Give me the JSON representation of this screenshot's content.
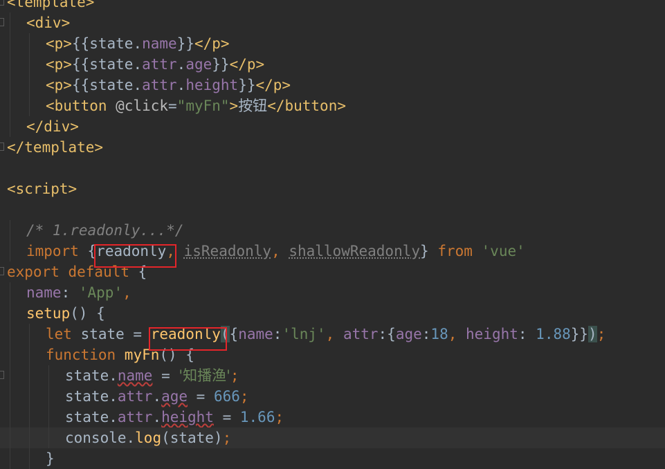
{
  "editor": {
    "lines": [
      {
        "indent": 0,
        "tokens": [
          {
            "t": "<template>",
            "c": "tag"
          }
        ]
      },
      {
        "indent": 1,
        "tokens": [
          {
            "t": "<div>",
            "c": "tag"
          }
        ]
      },
      {
        "indent": 2,
        "tokens": [
          {
            "t": "<p>",
            "c": "tag"
          },
          {
            "t": "{{",
            "c": "plain"
          },
          {
            "t": "state.",
            "c": "plain"
          },
          {
            "t": "name",
            "c": "prop"
          },
          {
            "t": "}}",
            "c": "plain"
          },
          {
            "t": "</p>",
            "c": "tag"
          }
        ]
      },
      {
        "indent": 2,
        "tokens": [
          {
            "t": "<p>",
            "c": "tag"
          },
          {
            "t": "{{",
            "c": "plain"
          },
          {
            "t": "state.",
            "c": "plain"
          },
          {
            "t": "attr",
            "c": "prop"
          },
          {
            "t": ".",
            "c": "plain"
          },
          {
            "t": "age",
            "c": "prop"
          },
          {
            "t": "}}",
            "c": "plain"
          },
          {
            "t": "</p>",
            "c": "tag"
          }
        ]
      },
      {
        "indent": 2,
        "tokens": [
          {
            "t": "<p>",
            "c": "tag"
          },
          {
            "t": "{{",
            "c": "plain"
          },
          {
            "t": "state.",
            "c": "plain"
          },
          {
            "t": "attr",
            "c": "prop"
          },
          {
            "t": ".",
            "c": "plain"
          },
          {
            "t": "height",
            "c": "prop"
          },
          {
            "t": "}}",
            "c": "plain"
          },
          {
            "t": "</p>",
            "c": "tag"
          }
        ]
      },
      {
        "indent": 2,
        "tokens": [
          {
            "t": "<button ",
            "c": "tag"
          },
          {
            "t": "@click",
            "c": "attr-name"
          },
          {
            "t": "=",
            "c": "plain"
          },
          {
            "t": "\"myFn\"",
            "c": "str"
          },
          {
            "t": ">",
            "c": "tag"
          },
          {
            "t": "按钮",
            "c": "plain cjk"
          },
          {
            "t": "</button>",
            "c": "tag"
          }
        ]
      },
      {
        "indent": 1,
        "tokens": [
          {
            "t": "</div>",
            "c": "tag"
          }
        ]
      },
      {
        "indent": 0,
        "tokens": [
          {
            "t": "</template>",
            "c": "tag"
          }
        ]
      },
      {
        "indent": 0,
        "tokens": []
      },
      {
        "indent": 0,
        "tokens": [
          {
            "t": "<script>",
            "c": "tag"
          }
        ]
      },
      {
        "indent": 0,
        "tokens": []
      },
      {
        "indent": 1,
        "tokens": [
          {
            "t": "/* 1.readonly...*/",
            "c": "comment"
          }
        ]
      },
      {
        "indent": 1,
        "tokens": [
          {
            "t": "import ",
            "c": "kw"
          },
          {
            "t": "{",
            "c": "plain"
          },
          {
            "t": "readonly",
            "c": "plain"
          },
          {
            "t": ", ",
            "c": "kw"
          },
          {
            "t": "isReadonly",
            "c": "unused"
          },
          {
            "t": ", ",
            "c": "kw"
          },
          {
            "t": "shallowReadonly",
            "c": "unused"
          },
          {
            "t": "} ",
            "c": "plain"
          },
          {
            "t": "from ",
            "c": "kw"
          },
          {
            "t": "'vue'",
            "c": "str"
          }
        ]
      },
      {
        "indent": 0,
        "tokens": [
          {
            "t": "export default ",
            "c": "kw"
          },
          {
            "t": "{",
            "c": "plain"
          }
        ]
      },
      {
        "indent": 1,
        "tokens": [
          {
            "t": "name",
            "c": "prop"
          },
          {
            "t": ": ",
            "c": "plain"
          },
          {
            "t": "'App'",
            "c": "str"
          },
          {
            "t": ",",
            "c": "kw"
          }
        ]
      },
      {
        "indent": 1,
        "tokens": [
          {
            "t": "setup",
            "c": "fn"
          },
          {
            "t": "() {",
            "c": "plain"
          }
        ]
      },
      {
        "indent": 2,
        "tokens": [
          {
            "t": "let ",
            "c": "kw"
          },
          {
            "t": "state = ",
            "c": "plain"
          },
          {
            "t": "readonly",
            "c": "fn"
          },
          {
            "t": "(",
            "c": "plain bracket-hl"
          },
          {
            "t": "{",
            "c": "plain"
          },
          {
            "t": "name",
            "c": "prop"
          },
          {
            "t": ":",
            "c": "plain"
          },
          {
            "t": "'lnj'",
            "c": "str"
          },
          {
            "t": ", ",
            "c": "kw"
          },
          {
            "t": "attr",
            "c": "prop"
          },
          {
            "t": ":{",
            "c": "plain"
          },
          {
            "t": "age",
            "c": "prop"
          },
          {
            "t": ":",
            "c": "plain"
          },
          {
            "t": "18",
            "c": "num"
          },
          {
            "t": ", ",
            "c": "kw"
          },
          {
            "t": "height",
            "c": "prop"
          },
          {
            "t": ": ",
            "c": "plain"
          },
          {
            "t": "1.88",
            "c": "num"
          },
          {
            "t": "}}",
            "c": "plain"
          },
          {
            "t": ")",
            "c": "plain bracket-hl"
          },
          {
            "t": ";",
            "c": "kw"
          }
        ]
      },
      {
        "indent": 2,
        "tokens": [
          {
            "t": "function ",
            "c": "kw"
          },
          {
            "t": "myFn",
            "c": "fn"
          },
          {
            "t": "() {",
            "c": "plain"
          }
        ]
      },
      {
        "indent": 3,
        "tokens": [
          {
            "t": "state.",
            "c": "plain"
          },
          {
            "t": "name",
            "c": "prop squiggle"
          },
          {
            "t": " = ",
            "c": "plain"
          },
          {
            "t": "'知播渔'",
            "c": "str cjk"
          },
          {
            "t": ";",
            "c": "kw"
          }
        ]
      },
      {
        "indent": 3,
        "tokens": [
          {
            "t": "state.",
            "c": "plain"
          },
          {
            "t": "attr",
            "c": "prop"
          },
          {
            "t": ".",
            "c": "plain"
          },
          {
            "t": "age",
            "c": "prop squiggle"
          },
          {
            "t": " = ",
            "c": "plain"
          },
          {
            "t": "666",
            "c": "num"
          },
          {
            "t": ";",
            "c": "kw"
          }
        ]
      },
      {
        "indent": 3,
        "tokens": [
          {
            "t": "state.",
            "c": "plain"
          },
          {
            "t": "attr",
            "c": "prop"
          },
          {
            "t": ".",
            "c": "plain"
          },
          {
            "t": "height",
            "c": "prop squiggle"
          },
          {
            "t": " = ",
            "c": "plain"
          },
          {
            "t": "1.66",
            "c": "num"
          },
          {
            "t": ";",
            "c": "kw"
          }
        ]
      },
      {
        "indent": 3,
        "current": true,
        "tokens": [
          {
            "t": "console.",
            "c": "plain"
          },
          {
            "t": "log",
            "c": "fn"
          },
          {
            "t": "(state)",
            "c": "plain"
          },
          {
            "t": ";",
            "c": "kw"
          }
        ]
      },
      {
        "indent": 2,
        "tokens": [
          {
            "t": "}",
            "c": "plain"
          }
        ]
      }
    ]
  },
  "annotations": [
    "readonly-import-highlight",
    "readonly-call-highlight"
  ],
  "colors": {
    "background": "#2b2b2b",
    "tag": "#e8bf6a",
    "keyword": "#cc7832",
    "string": "#6a8759",
    "number": "#6897bb",
    "property": "#9876aa",
    "function": "#ffc66d",
    "comment": "#808080",
    "annotation_box": "#e5252a"
  }
}
